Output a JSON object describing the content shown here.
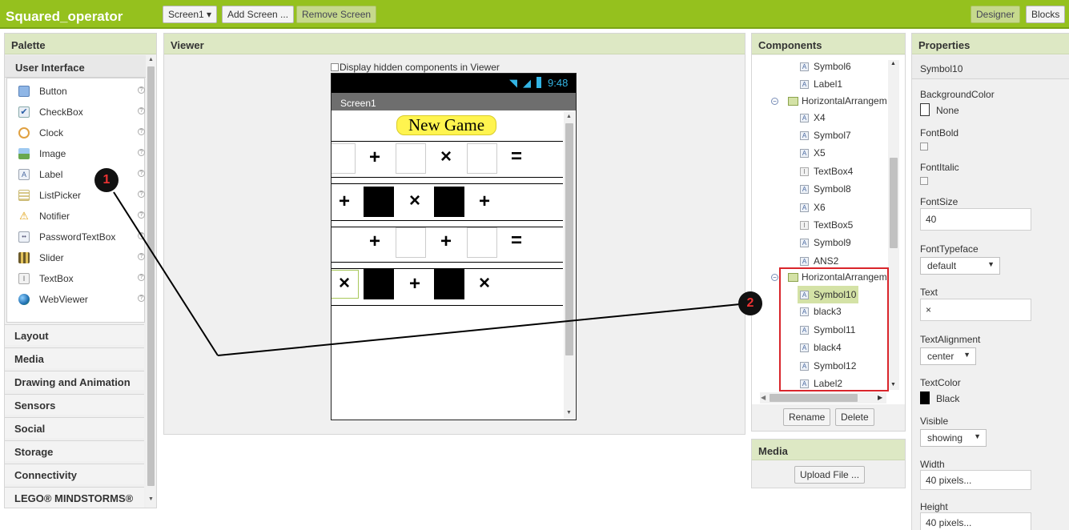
{
  "app": {
    "title": "Squared_operator"
  },
  "toolbar": {
    "screen_select": "Screen1 ▾",
    "add_screen": "Add Screen ...",
    "remove_screen": "Remove Screen",
    "designer": "Designer",
    "blocks": "Blocks"
  },
  "palette": {
    "title": "Palette",
    "section": "User Interface",
    "items": [
      {
        "label": "Button",
        "icon": "button-icon"
      },
      {
        "label": "CheckBox",
        "icon": "checkbox-icon"
      },
      {
        "label": "Clock",
        "icon": "clock-icon"
      },
      {
        "label": "Image",
        "icon": "image-icon"
      },
      {
        "label": "Label",
        "icon": "label-icon"
      },
      {
        "label": "ListPicker",
        "icon": "listpicker-icon"
      },
      {
        "label": "Notifier",
        "icon": "notifier-icon"
      },
      {
        "label": "PasswordTextBox",
        "icon": "password-icon"
      },
      {
        "label": "Slider",
        "icon": "slider-icon"
      },
      {
        "label": "TextBox",
        "icon": "textbox-icon"
      },
      {
        "label": "WebViewer",
        "icon": "webviewer-icon"
      }
    ],
    "help": "?",
    "categories": [
      "Layout",
      "Media",
      "Drawing and Animation",
      "Sensors",
      "Social",
      "Storage",
      "Connectivity",
      "LEGO® MINDSTORMS®"
    ]
  },
  "viewer": {
    "title": "Viewer",
    "hidden_checkbox_label": "Display hidden components in Viewer",
    "status_time": "9:48",
    "screen_name": "Screen1",
    "new_game": "New Game",
    "symbols": {
      "plus": "+",
      "times": "×",
      "equals": "="
    }
  },
  "components": {
    "title": "Components",
    "items": [
      "Symbol6",
      "Label1",
      "HorizontalArrangem",
      "X4",
      "Symbol7",
      "X5",
      "TextBox4",
      "Symbol8",
      "X6",
      "TextBox5",
      "Symbol9",
      "ANS2",
      "HorizontalArrangem",
      "Symbol10",
      "black3",
      "Symbol11",
      "black4",
      "Symbol12",
      "Label2"
    ],
    "rename": "Rename",
    "delete": "Delete"
  },
  "media": {
    "title": "Media",
    "upload": "Upload File ..."
  },
  "properties": {
    "title": "Properties",
    "component": "Symbol10",
    "bg_label": "BackgroundColor",
    "bg_value": "None",
    "fontbold_label": "FontBold",
    "fontitalic_label": "FontItalic",
    "fontsize_label": "FontSize",
    "fontsize_value": "40",
    "typeface_label": "FontTypeface",
    "typeface_value": "default",
    "text_label": "Text",
    "text_value": "×",
    "align_label": "TextAlignment",
    "align_value": "center",
    "textcolor_label": "TextColor",
    "textcolor_value": "Black",
    "visible_label": "Visible",
    "visible_value": "showing",
    "width_label": "Width",
    "width_value": "40 pixels...",
    "height_label": "Height",
    "height_value": "40 pixels..."
  },
  "annotations": {
    "m1": "1",
    "m2": "2"
  },
  "colors": {
    "topbar": "#95c11e",
    "highlight": "#d4e2a6",
    "selection_box": "#d9252b",
    "new_game_bg": "#fff44f"
  }
}
